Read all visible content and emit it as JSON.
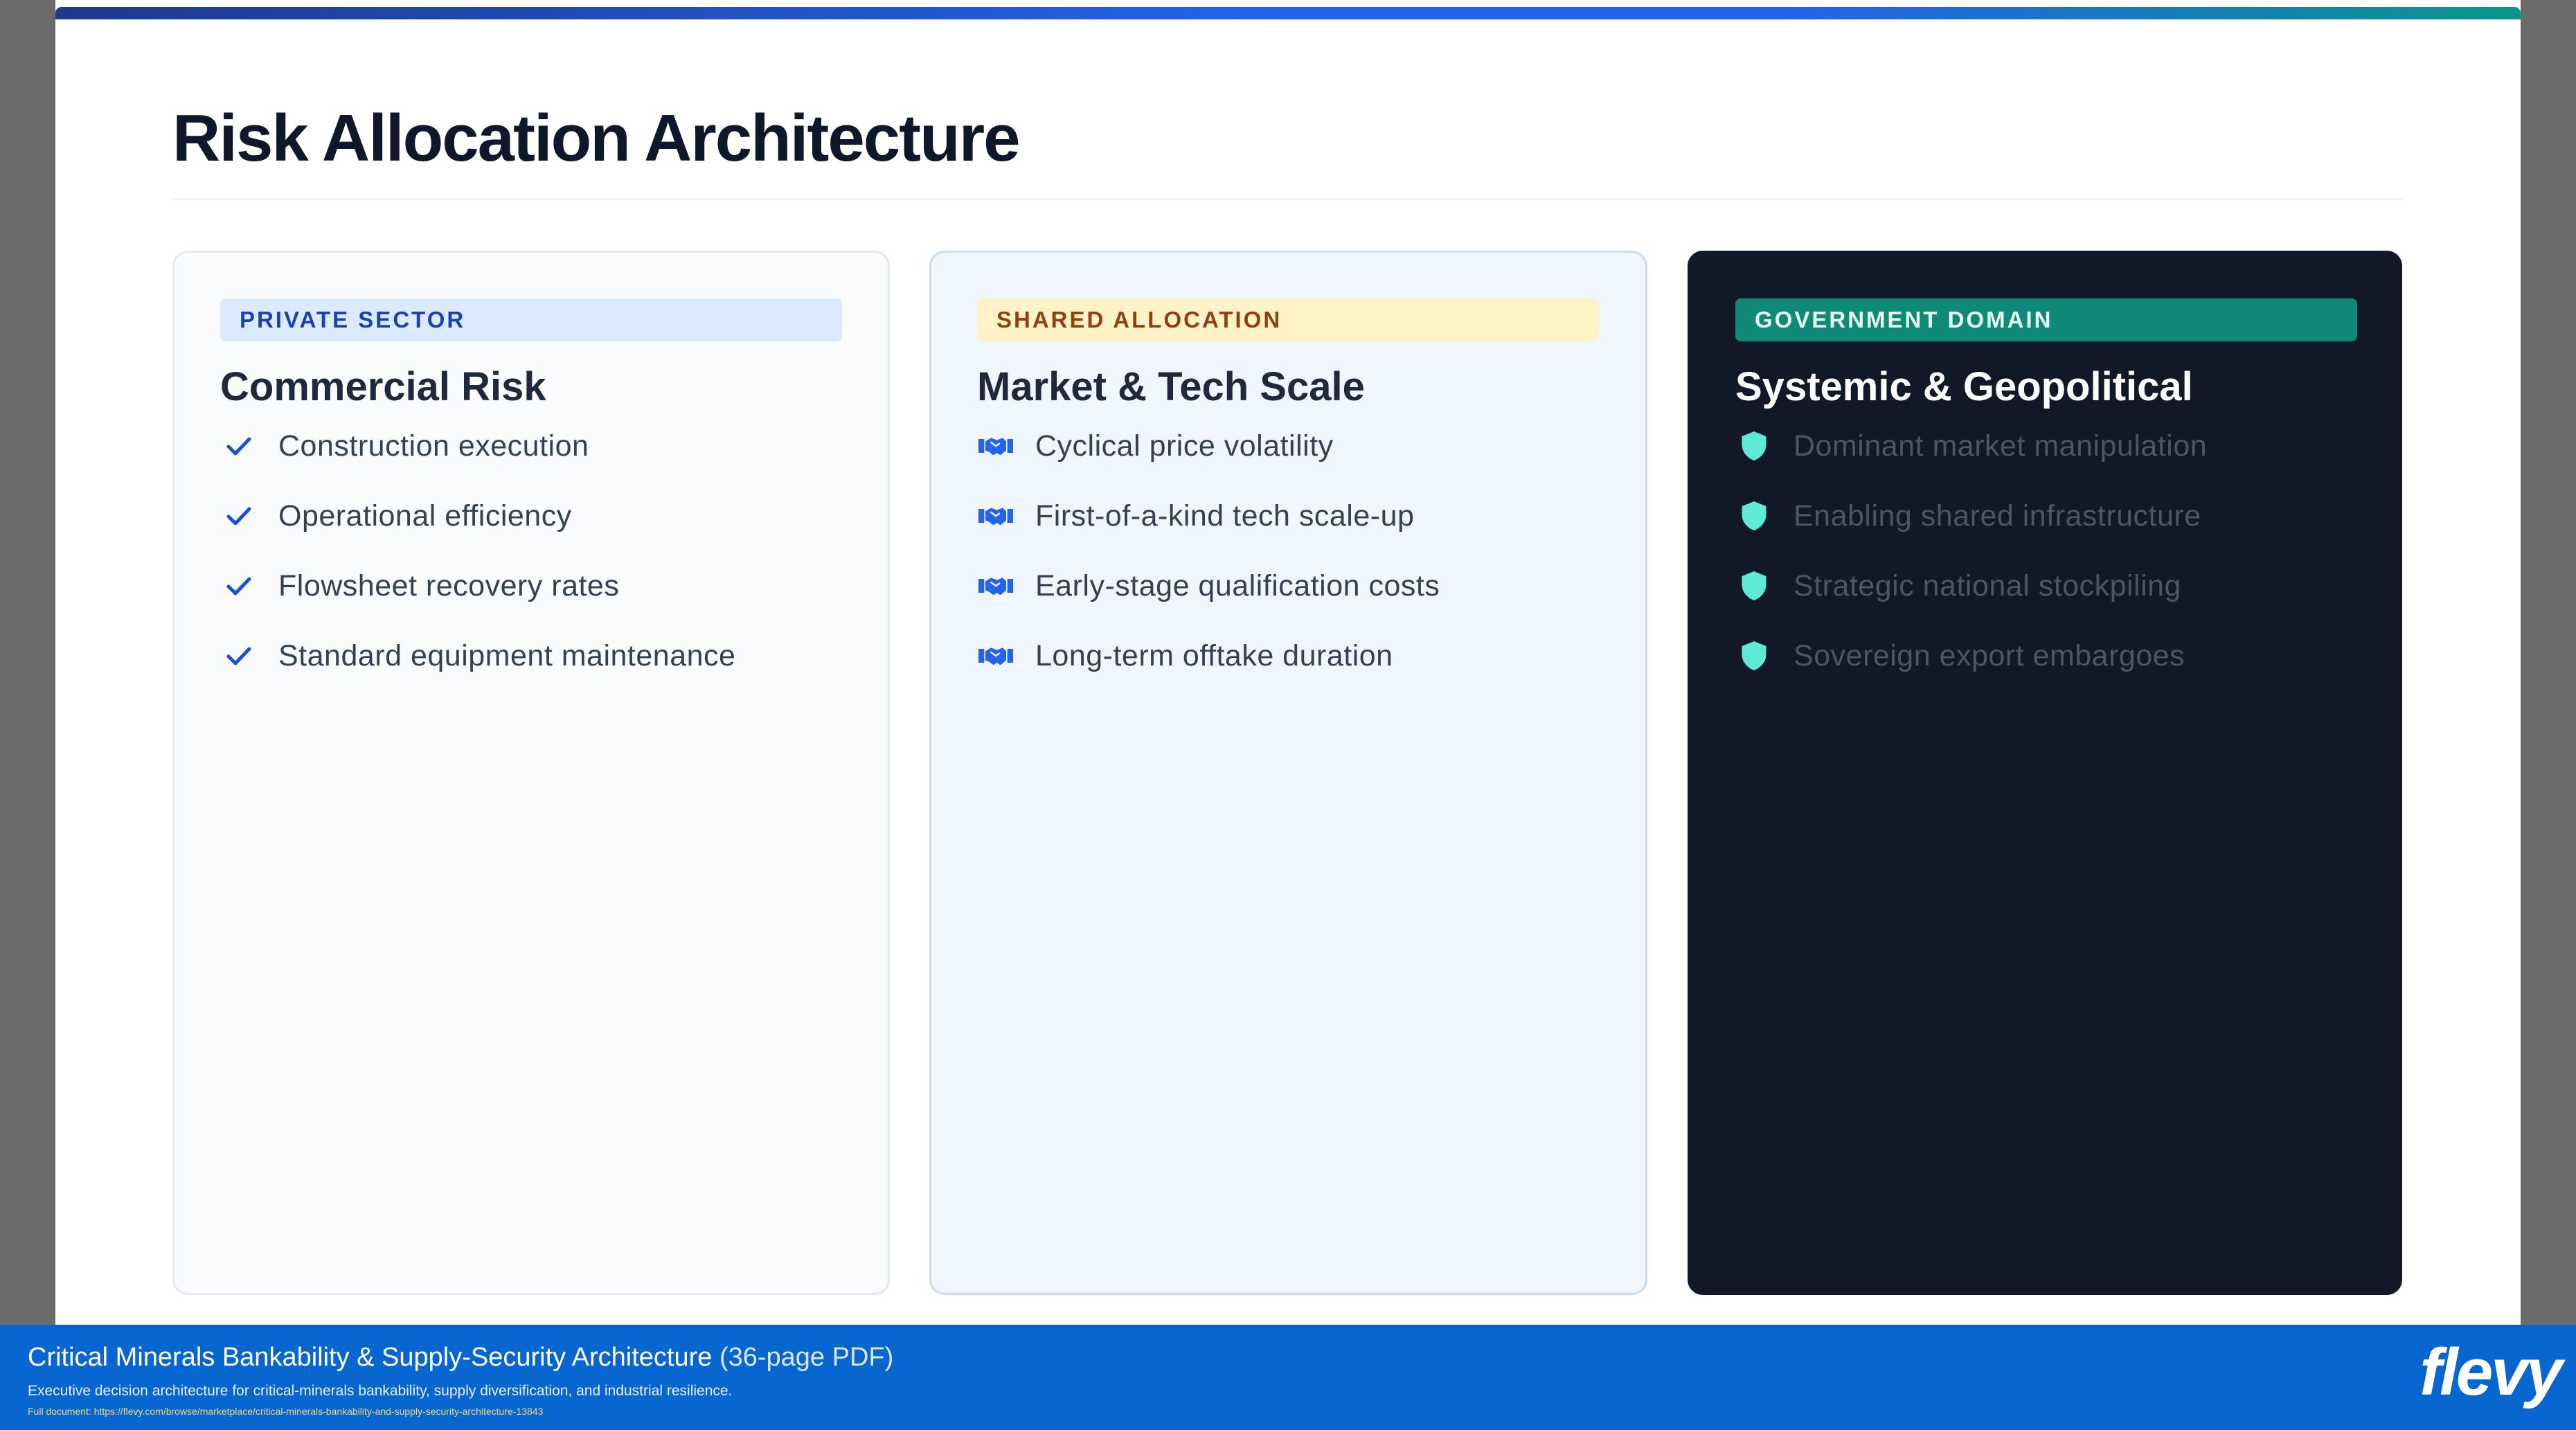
{
  "slide": {
    "title": "Risk Allocation Architecture"
  },
  "columns": [
    {
      "badge": "PRIVATE SECTOR",
      "title": "Commercial Risk",
      "icon": "check-icon",
      "items": [
        "Construction execution",
        "Operational efficiency",
        "Flowsheet recovery rates",
        "Standard equipment maintenance"
      ]
    },
    {
      "badge": "SHARED ALLOCATION",
      "title": "Market & Tech Scale",
      "icon": "handshake-icon",
      "items": [
        "Cyclical price volatility",
        "First-of-a-kind tech scale-up",
        "Early-stage qualification costs",
        "Long-term offtake duration"
      ]
    },
    {
      "badge": "GOVERNMENT DOMAIN",
      "title": "Systemic & Geopolitical",
      "icon": "shield-icon",
      "items": [
        "Dominant market manipulation",
        "Enabling shared infrastructure",
        "Strategic national stockpiling",
        "Sovereign export embargoes"
      ]
    }
  ],
  "footer": {
    "title": "Critical Minerals Bankability & Supply-Security Architecture",
    "pages": "(36-page PDF)",
    "subtitle": "Executive decision architecture for critical-minerals bankability, supply diversification, and industrial resilience.",
    "url": "Full document: https://flevy.com/browse/marketplace/critical-minerals-bankability-and-supply-security-architecture-13843",
    "brand": "flevy"
  },
  "colors": {
    "private_accent": "#1d4ed8",
    "shared_accent": "#2563eb",
    "gov_accent": "#5eead4",
    "footer_bg": "#0866d1"
  }
}
